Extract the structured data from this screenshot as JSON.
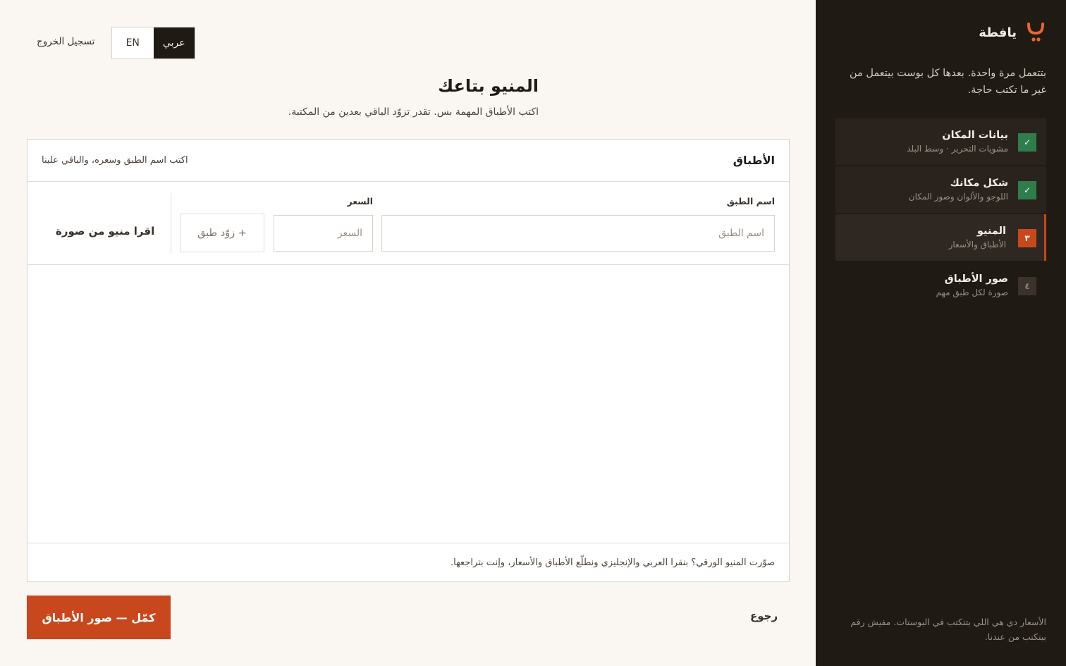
{
  "brand": {
    "name": "يافطة",
    "logo": "ي-letter-logo",
    "accent": "#c9471d"
  },
  "sidebar": {
    "intro": "بتتعمل مرة واحدة. بعدها كل بوست بيتعمل من غير ما تكتب حاجة.",
    "steps": [
      {
        "badge": "✓",
        "title": "بيانات المكان",
        "subtitle": "مشويات التحرير · وسط البلد",
        "state": "done"
      },
      {
        "badge": "✓",
        "title": "شكل مكانك",
        "subtitle": "اللوجو والألوان وصور المكان",
        "state": "done"
      },
      {
        "badge": "٣",
        "title": "المنيو",
        "subtitle": "الأطباق والأسعار",
        "state": "current"
      },
      {
        "badge": "٤",
        "title": "صور الأطباق",
        "subtitle": "صورة لكل طبق مهم",
        "state": "todo"
      }
    ],
    "note": "الأسعار دي هي اللي بتتكتب في البوستات. مفيش رقم بيتكتب من عندنا."
  },
  "header": {
    "logout": "تسجيل الخروج",
    "lang_ar": "عربي",
    "lang_en": "EN"
  },
  "main": {
    "title": "المنيو بتاعك",
    "subtitle": "اكتب الأطباق المهمة بس. تقدر تزوّد الباقي بعدين من المكتبة.",
    "card": {
      "title": "الأطباق",
      "hint": "اكتب اسم الطبق وسعره، والباقي علينا",
      "name_label": "اسم الطبق",
      "name_placeholder": "اسم الطبق",
      "price_label": "السعر",
      "price_placeholder": "السعر",
      "add_label": "+ زوّد طبق",
      "scan_label": "اقرا منيو من صورة",
      "footer": "صوّرت المنيو الورقي؟ بنقرا العربي والإنجليزي ونطلّع الأطباق والأسعار، وإنت بتراجعها."
    },
    "back": "رجوع",
    "next": "كمّل — صور الأطباق"
  },
  "colors": {
    "sidebar_bg": "#201a15",
    "page_bg": "#faf7f2",
    "done": "#2f7d4b",
    "current": "#c9471d"
  }
}
